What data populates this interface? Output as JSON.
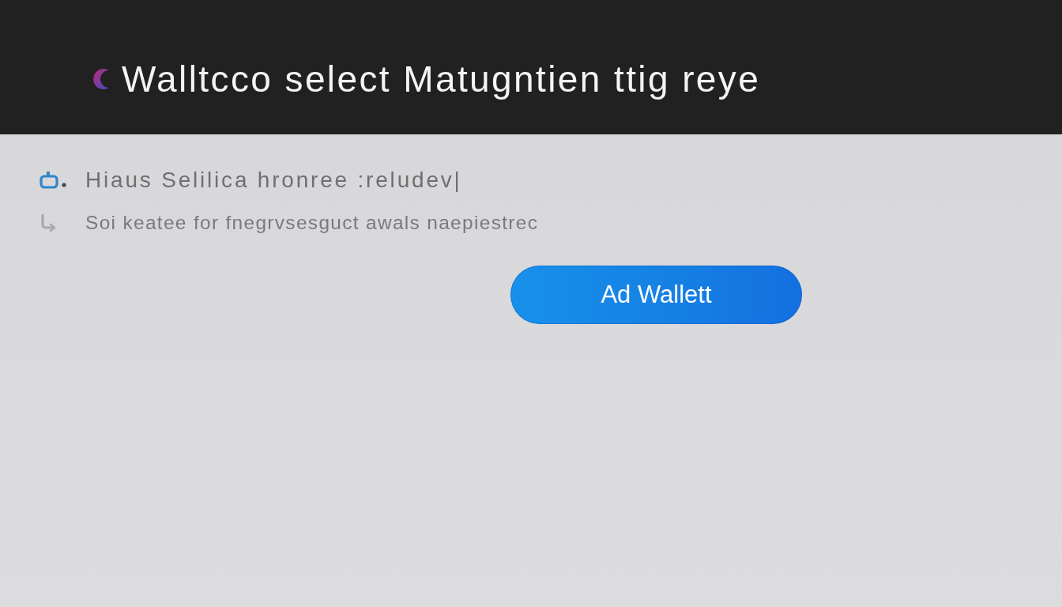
{
  "header": {
    "title": "Walltcco select Matugntien ttig reye"
  },
  "items": [
    {
      "kind": "primary",
      "text": "Hiaus Selilica hronree :reludev|"
    },
    {
      "kind": "secondary",
      "text": "Soi keatee for fnegrvsesguct awals naepiestrec"
    }
  ],
  "button": {
    "label": "Ad Wallett"
  }
}
